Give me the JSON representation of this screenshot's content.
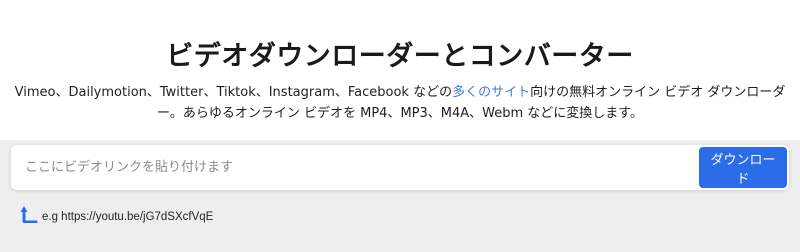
{
  "header": {
    "title": "ビデオダウンローダーとコンバーター"
  },
  "description": {
    "part1": "Vimeo、Dailymotion、Twitter、Tiktok、Instagram、Facebook などの",
    "link": "多くのサイト",
    "part2": "向けの無料オンライン ビデオ ダウンローダー。あらゆるオンライン ビデオを MP4、MP3、M4A、Webm などに変換します。"
  },
  "search": {
    "placeholder": "ここにビデオリンクを貼り付けます",
    "value": "",
    "button_label": "ダウンロード"
  },
  "example": {
    "text": "e.g https://youtu.be/jG7dSXcfVqE",
    "icon": "curved-arrow-up-icon"
  },
  "colors": {
    "accent": "#2b6de9",
    "link": "#3f7fd9",
    "panel": "#eeeeee"
  }
}
